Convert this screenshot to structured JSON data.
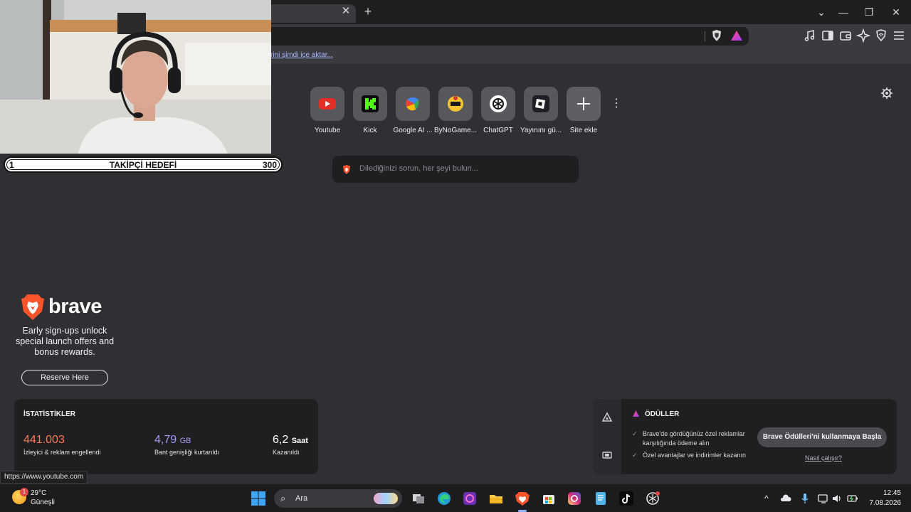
{
  "browser": {
    "tab_close": "✕",
    "new_tab": "+",
    "window_controls": [
      "⌄",
      "—",
      "❐",
      "✕"
    ],
    "import_link": "rini şimdi içe aktar..."
  },
  "toolbar_icons": [
    "music-icon",
    "sidebar-icon",
    "wallet-icon",
    "leo-ai-icon",
    "vpn-shield-icon",
    "menu-icon"
  ],
  "overlay": {
    "follow_start": "1",
    "follow_label": "TAKİPÇİ HEDEFİ",
    "follow_goal": "300"
  },
  "shortcuts": [
    {
      "label": "Youtube",
      "icon": "youtube-icon",
      "color": "#e52d27"
    },
    {
      "label": "Kick",
      "icon": "kick-icon",
      "color": "#53fc18"
    },
    {
      "label": "Google AI ...",
      "icon": "google-ai-icon",
      "color": "#4285f4"
    },
    {
      "label": "ByNoGame...",
      "icon": "bynogame-icon",
      "color": "#f4c430"
    },
    {
      "label": "ChatGPT",
      "icon": "chatgpt-icon",
      "color": "#ffffff"
    },
    {
      "label": "Yayınını gü...",
      "icon": "streamelements-icon",
      "color": "#1e1e24"
    },
    {
      "label": "Site ekle",
      "icon": "plus-icon",
      "color": "#5e5e63"
    }
  ],
  "shortcut_more": "⋮",
  "search": {
    "placeholder": "Dilediğinizi sorun, her şeyi bulun..."
  },
  "ad": {
    "brand": "brave",
    "text": "Early sign-ups unlock special launch offers and bonus rewards.",
    "button": "Reserve Here"
  },
  "stats": {
    "title": "İSTATİSTİKLER",
    "blocked": {
      "value": "441.003",
      "desc": "İzleyici & reklam engellendi",
      "color": "#ff7a55"
    },
    "bandwidth": {
      "value": "4,79",
      "unit": "GB",
      "desc": "Bant genişliği kurtarıldı",
      "color": "#a59cff"
    },
    "time": {
      "value": "6,2",
      "unit": "Saat",
      "desc": "Kazanıldı",
      "color": "#ffffff"
    }
  },
  "rewards": {
    "title": "ÖDÜLLER",
    "item1": "Brave'de gördüğünüz özel reklamlar karşılığında ödeme alın",
    "item2": "Özel avantajlar ve indirimler kazanın",
    "button": "Brave Ödülleri'ni kullanmaya Başla",
    "link": "Nasıl çalışır?"
  },
  "status_url": "https://www.youtube.com",
  "taskbar": {
    "weather_badge": "1",
    "temp": "29°C",
    "weather": "Güneşli",
    "search": "Ara",
    "apps": [
      "taskview-icon",
      "edge-icon",
      "pink-app-icon",
      "file-explorer-icon",
      "brave-icon",
      "store-icon",
      "instagram-icon",
      "notepad-icon",
      "tiktok-icon",
      "chatgpt-app-icon"
    ],
    "time": "12:45",
    "date": "7.08.2026"
  }
}
